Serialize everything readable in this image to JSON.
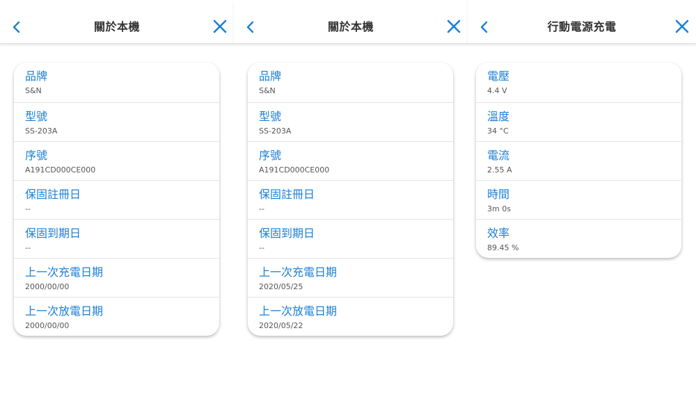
{
  "colors": {
    "accent": "#1a7fd6",
    "text": "#333333",
    "subtext": "#555555"
  },
  "screens": [
    {
      "title": "關於本機",
      "back_icon": "chevron-left-icon",
      "close_icon": "close-icon",
      "rows": [
        {
          "label": "品牌",
          "value": "S&N"
        },
        {
          "label": "型號",
          "value": "SS-203A"
        },
        {
          "label": "序號",
          "value": "A191CD000CE000"
        },
        {
          "label": "保固註冊日",
          "value": "--"
        },
        {
          "label": "保固到期日",
          "value": "--"
        },
        {
          "label": "上一次充電日期",
          "value": "2000/00/00"
        },
        {
          "label": "上一次放電日期",
          "value": "2000/00/00"
        }
      ]
    },
    {
      "title": "關於本機",
      "back_icon": "chevron-left-icon",
      "close_icon": "close-icon",
      "rows": [
        {
          "label": "品牌",
          "value": "S&N"
        },
        {
          "label": "型號",
          "value": "SS-203A"
        },
        {
          "label": "序號",
          "value": "A191CD000CE000"
        },
        {
          "label": "保固註冊日",
          "value": "--"
        },
        {
          "label": "保固到期日",
          "value": "--"
        },
        {
          "label": "上一次充電日期",
          "value": "2020/05/25"
        },
        {
          "label": "上一次放電日期",
          "value": "2020/05/22"
        }
      ]
    },
    {
      "title": "行動電源充電",
      "back_icon": "chevron-left-icon",
      "close_icon": "close-icon",
      "rows": [
        {
          "label": "電壓",
          "value": "4.4 V"
        },
        {
          "label": "溫度",
          "value": "34 °C"
        },
        {
          "label": "電流",
          "value": "2.55 A"
        },
        {
          "label": "時間",
          "value": "3m 0s"
        },
        {
          "label": "效率",
          "value": "89.45 %"
        }
      ]
    }
  ]
}
